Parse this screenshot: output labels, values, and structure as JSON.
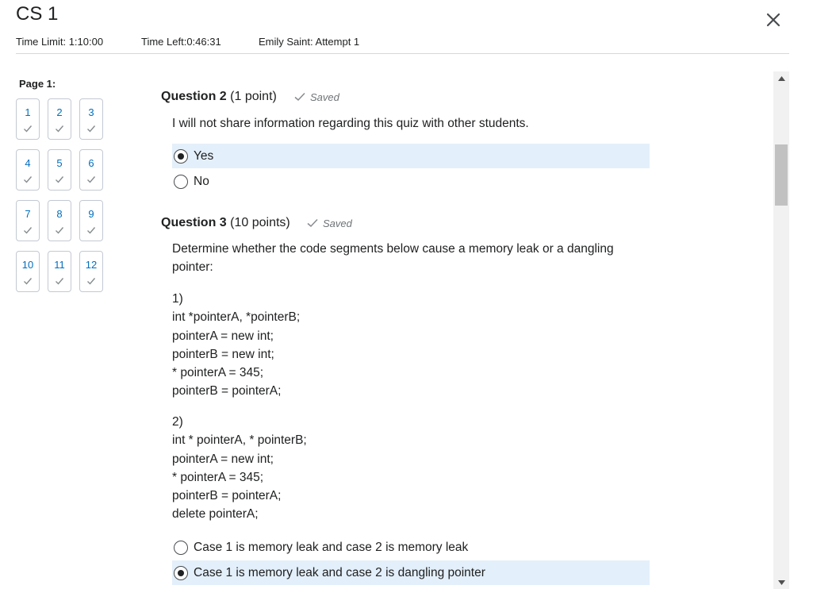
{
  "header": {
    "title": "CS 1",
    "time_limit": "Time Limit: 1:10:00",
    "time_left": "Time Left:0:46:31",
    "attempt": "Emily Saint: Attempt 1"
  },
  "nav": {
    "page_label": "Page 1:",
    "questions": [
      "1",
      "2",
      "3",
      "4",
      "5",
      "6",
      "7",
      "8",
      "9",
      "10",
      "11",
      "12"
    ]
  },
  "question2": {
    "title": "Question 2",
    "points": "(1 point)",
    "status": "Saved",
    "text": "I will not share information regarding this quiz with other students.",
    "options": [
      {
        "label": "Yes",
        "selected": true
      },
      {
        "label": "No",
        "selected": false
      }
    ]
  },
  "question3": {
    "title": "Question 3",
    "points": "(10 points)",
    "status": "Saved",
    "text_line1": "Determine whether the code segments below cause a memory leak or a dangling",
    "text_line2": "pointer:",
    "code1": [
      "1)",
      "int *pointerA, *pointerB;",
      "pointerA = new int;",
      "pointerB = new int;",
      "* pointerA = 345;",
      "pointerB = pointerA;"
    ],
    "code2": [
      "2)",
      "int * pointerA, * pointerB;",
      "pointerA = new int;",
      "* pointerA = 345;",
      "pointerB = pointerA;",
      "delete pointerA;"
    ],
    "options": [
      {
        "label": "Case 1 is memory leak and case 2 is memory leak",
        "selected": false
      },
      {
        "label": "Case 1 is memory leak and case 2 is dangling pointer",
        "selected": true
      }
    ]
  },
  "colors": {
    "accent": "#006fbf",
    "selected_bg": "#e3effa",
    "check": "#868c8f"
  },
  "icons": {
    "close": "close-icon",
    "check": "checkmark-icon",
    "scroll_up": "arrow-up-icon",
    "scroll_down": "arrow-down-icon"
  }
}
